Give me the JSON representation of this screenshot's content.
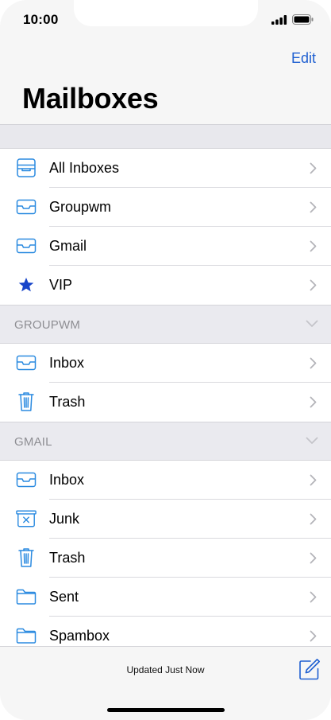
{
  "status_bar": {
    "time": "10:00"
  },
  "header": {
    "edit_label": "Edit",
    "title": "Mailboxes"
  },
  "favorites": [
    {
      "label": "All Inboxes",
      "icon": "all-inboxes-icon"
    },
    {
      "label": "Groupwm",
      "icon": "inbox-tray-icon"
    },
    {
      "label": "Gmail",
      "icon": "inbox-tray-icon"
    },
    {
      "label": "VIP",
      "icon": "star-icon"
    }
  ],
  "accounts": [
    {
      "name": "GROUPWM",
      "items": [
        {
          "label": "Inbox",
          "icon": "inbox-tray-icon"
        },
        {
          "label": "Trash",
          "icon": "trash-icon"
        }
      ]
    },
    {
      "name": "GMAIL",
      "items": [
        {
          "label": "Inbox",
          "icon": "inbox-tray-icon"
        },
        {
          "label": "Junk",
          "icon": "junk-icon"
        },
        {
          "label": "Trash",
          "icon": "trash-icon"
        },
        {
          "label": "Sent",
          "icon": "folder-icon"
        },
        {
          "label": "Spambox",
          "icon": "folder-icon"
        }
      ]
    }
  ],
  "toolbar": {
    "status_text": "Updated Just Now"
  },
  "colors": {
    "accent": "#1e5fd1",
    "icon_blue": "#2a8ae0",
    "vip_star": "#1744c9",
    "secondary_text": "#8e8e93"
  }
}
